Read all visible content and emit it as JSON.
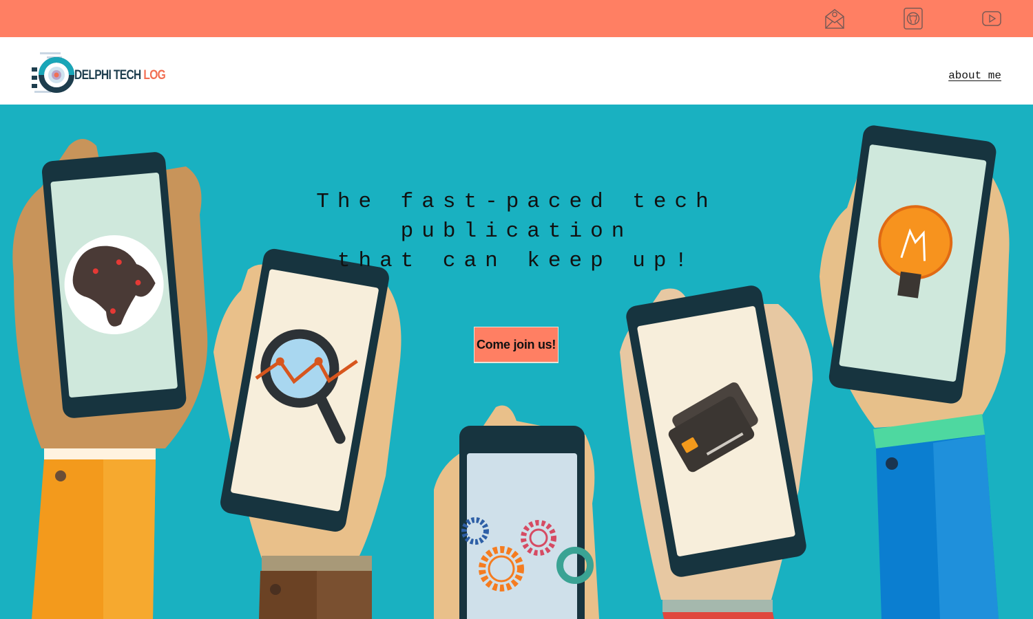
{
  "topbar": {
    "icons": [
      {
        "name": "email-icon"
      },
      {
        "name": "github-icon"
      },
      {
        "name": "youtube-icon"
      }
    ],
    "color": "#ff7f63"
  },
  "navbar": {
    "logo": {
      "text_primary": "DELPHI TECH",
      "text_accent": "LOG"
    },
    "about_label": "about me"
  },
  "hero": {
    "background": "#19b1c1",
    "tagline_line1": "The fast-paced tech publication",
    "tagline_line2": "that can keep up!",
    "cta_label": "Come join us!"
  }
}
